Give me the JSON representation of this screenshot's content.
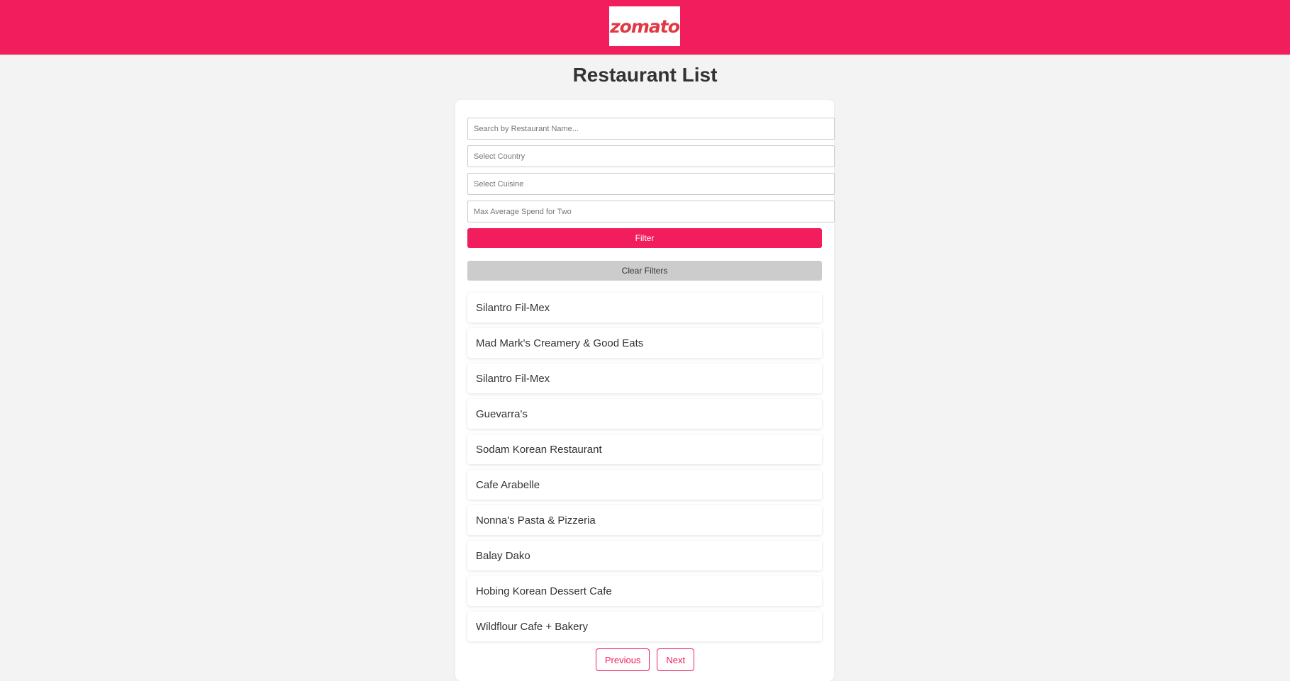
{
  "header": {
    "logo_text": "zomato",
    "brand_color": "#f21d5d",
    "logo_color": "#e23744"
  },
  "page": {
    "title": "Restaurant List"
  },
  "filters": {
    "search_placeholder": "Search by Restaurant Name...",
    "country_placeholder": "Select Country",
    "cuisine_placeholder": "Select Cuisine",
    "spend_placeholder": "Max Average Spend for Two",
    "filter_label": "Filter",
    "clear_label": "Clear Filters"
  },
  "restaurants": [
    "Silantro Fil-Mex",
    "Mad Mark's Creamery & Good Eats",
    "Silantro Fil-Mex",
    "Guevarra's",
    "Sodam Korean Restaurant",
    "Cafe Arabelle",
    "Nonna's Pasta & Pizzeria",
    "Balay Dako",
    "Hobing Korean Dessert Cafe",
    "Wildflour Cafe + Bakery"
  ],
  "pagination": {
    "previous_label": "Previous",
    "next_label": "Next"
  }
}
